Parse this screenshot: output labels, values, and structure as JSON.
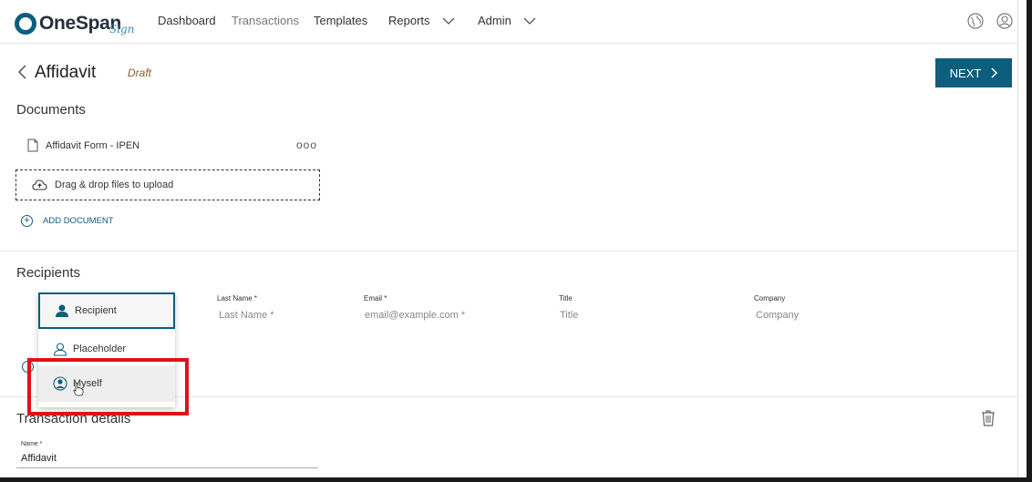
{
  "app": {
    "logo_text": "OneSpan",
    "logo_sub": "Sign",
    "nav": [
      "Dashboard",
      "Transactions",
      "Templates",
      "Reports",
      "Admin"
    ]
  },
  "header": {
    "title": "Affidavit",
    "status": "Draft",
    "next_label": "NEXT"
  },
  "documents": {
    "heading": "Documents",
    "items": [
      "Affidavit Form - IPEN"
    ],
    "more": "ooo",
    "dropzone_label": "Drag & drop files to upload",
    "add_label": "ADD DOCUMENT"
  },
  "recipients": {
    "heading": "Recipients",
    "columns": [
      {
        "label": "Last Name *",
        "placeholder": "Last Name *"
      },
      {
        "label": "Email *",
        "placeholder": "email@example.com *"
      },
      {
        "label": "Title",
        "placeholder": "Title"
      },
      {
        "label": "Company",
        "placeholder": "Company"
      }
    ],
    "type_menu": [
      "Recipient",
      "Placeholder",
      "Myself"
    ],
    "selected": "Recipient",
    "hovered": "Myself"
  },
  "transaction_details": {
    "heading": "Transaction details",
    "name_label": "Name *",
    "name_value": "Affidavit"
  },
  "colors": {
    "brand": "#0d5e7c",
    "highlight": "#e0111b",
    "draft": "#8a5a2b"
  }
}
